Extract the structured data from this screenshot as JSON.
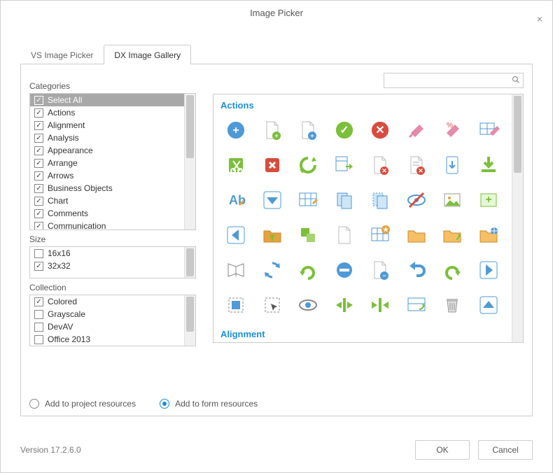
{
  "title": "Image Picker",
  "tabs": [
    "VS Image Picker",
    "DX Image Gallery"
  ],
  "active_tab": 1,
  "search": {
    "placeholder": ""
  },
  "section_labels": {
    "categories": "Categories",
    "size": "Size",
    "collection": "Collection"
  },
  "categories": [
    {
      "label": "Select All",
      "checked": true,
      "selected": true
    },
    {
      "label": "Actions",
      "checked": true
    },
    {
      "label": "Alignment",
      "checked": true
    },
    {
      "label": "Analysis",
      "checked": true
    },
    {
      "label": "Appearance",
      "checked": true
    },
    {
      "label": "Arrange",
      "checked": true
    },
    {
      "label": "Arrows",
      "checked": true
    },
    {
      "label": "Business Objects",
      "checked": true
    },
    {
      "label": "Chart",
      "checked": true
    },
    {
      "label": "Comments",
      "checked": true
    },
    {
      "label": "Communication",
      "checked": true
    }
  ],
  "sizes": [
    {
      "label": "16x16",
      "checked": false
    },
    {
      "label": "32x32",
      "checked": true
    }
  ],
  "collections": [
    {
      "label": "Colored",
      "checked": true
    },
    {
      "label": "Grayscale",
      "checked": false
    },
    {
      "label": "DevAV",
      "checked": false
    },
    {
      "label": "Office 2013",
      "checked": false
    }
  ],
  "gallery_groups": [
    {
      "name": "Actions",
      "icons": [
        "add",
        "add-file",
        "add-item",
        "apply",
        "cancel",
        "clear",
        "clear-format",
        "clear-table",
        "cut",
        "close",
        "refresh",
        "convert",
        "delete-item",
        "delete-list",
        "down-file",
        "download",
        "text",
        "down-box",
        "delete-table",
        "copy",
        "paste",
        "hide",
        "image",
        "add-image",
        "back",
        "open-up",
        "group",
        "blank",
        "new-grid",
        "folder",
        "folder-up",
        "folder-web",
        "book",
        "sync",
        "redo",
        "forbid",
        "remove-item",
        "undo",
        "reload",
        "export",
        "select",
        "select-cursor",
        "view",
        "in",
        "out",
        "design",
        "trash",
        "upload"
      ]
    },
    {
      "name": "Alignment",
      "icons": []
    }
  ],
  "radios": [
    {
      "label": "Add to project resources",
      "selected": false
    },
    {
      "label": "Add to form resources",
      "selected": true
    }
  ],
  "version": "Version 17.2.6.0",
  "buttons": {
    "ok": "OK",
    "cancel": "Cancel"
  },
  "colors": {
    "accent": "#1a8fd8",
    "green": "#7bbf3a",
    "red": "#d94b3d",
    "blue": "#4f9ad6",
    "orange": "#e6a23c",
    "grey": "#999"
  }
}
